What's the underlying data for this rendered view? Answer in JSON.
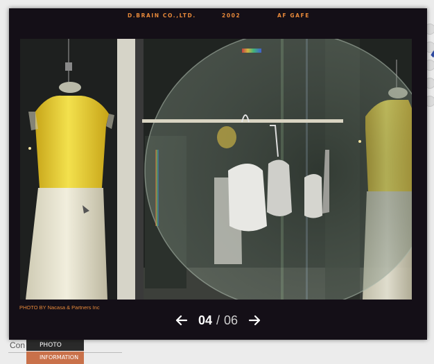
{
  "header": {
    "company": "D.BRAIN CO.,LTD.",
    "year": "2002",
    "project": "AF GAFE"
  },
  "photo": {
    "credit": "PHOTO BY Nacasa & Partners Inc"
  },
  "pager": {
    "current": "04",
    "separator": "/",
    "total": "06",
    "prev_icon": "arrow-left-icon",
    "next_icon": "arrow-right-icon"
  },
  "background": {
    "partial_text": "Con",
    "menu_photo": "PHOTO",
    "menu_information": "INFORMATION"
  },
  "colors": {
    "modal_bg": "#140f17",
    "accent": "#e8893a",
    "menu_active": "#c9714a"
  }
}
